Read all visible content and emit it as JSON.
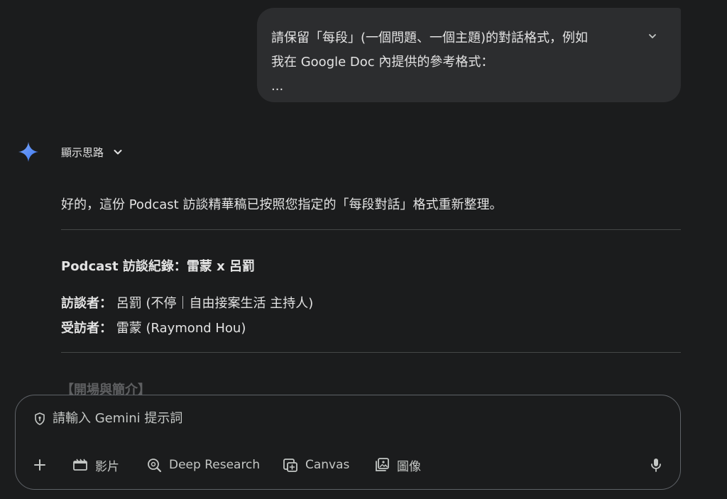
{
  "user_message": {
    "lines": [
      "請保留「每段」(一個問題、一個主題)的對話格式，例如",
      "我在 Google Doc 內提供的參考格式：",
      "..."
    ],
    "expand_icon": "chevron-down-icon"
  },
  "response": {
    "thoughts_label": "顯示思路",
    "intro": "好的，這份 Podcast 訪談精華稿已按照您指定的「每段對話」格式重新整理。",
    "title": "Podcast 訪談紀錄：雷蒙 x 呂罰",
    "interviewer_label": "訪談者：",
    "interviewer_value": "呂罰 (不停｜自由接案生活 主持人)",
    "interviewee_label": "受訪者：",
    "interviewee_value": "雷蒙 (Raymond Hou)",
    "section_heading": "【開場與簡介】"
  },
  "composer": {
    "placeholder": "請輸入 Gemini 提示詞",
    "tools": [
      {
        "label": "影片",
        "icon": "video-icon"
      },
      {
        "label": "Deep Research",
        "icon": "deep-research-icon"
      },
      {
        "label": "Canvas",
        "icon": "canvas-icon"
      },
      {
        "label": "圖像",
        "icon": "image-icon"
      }
    ]
  },
  "colors": {
    "background": "#1b1c1d",
    "bubble": "#2c2d2f",
    "gemini_blue": "#4c8df6",
    "text": "#e3e3e3"
  }
}
